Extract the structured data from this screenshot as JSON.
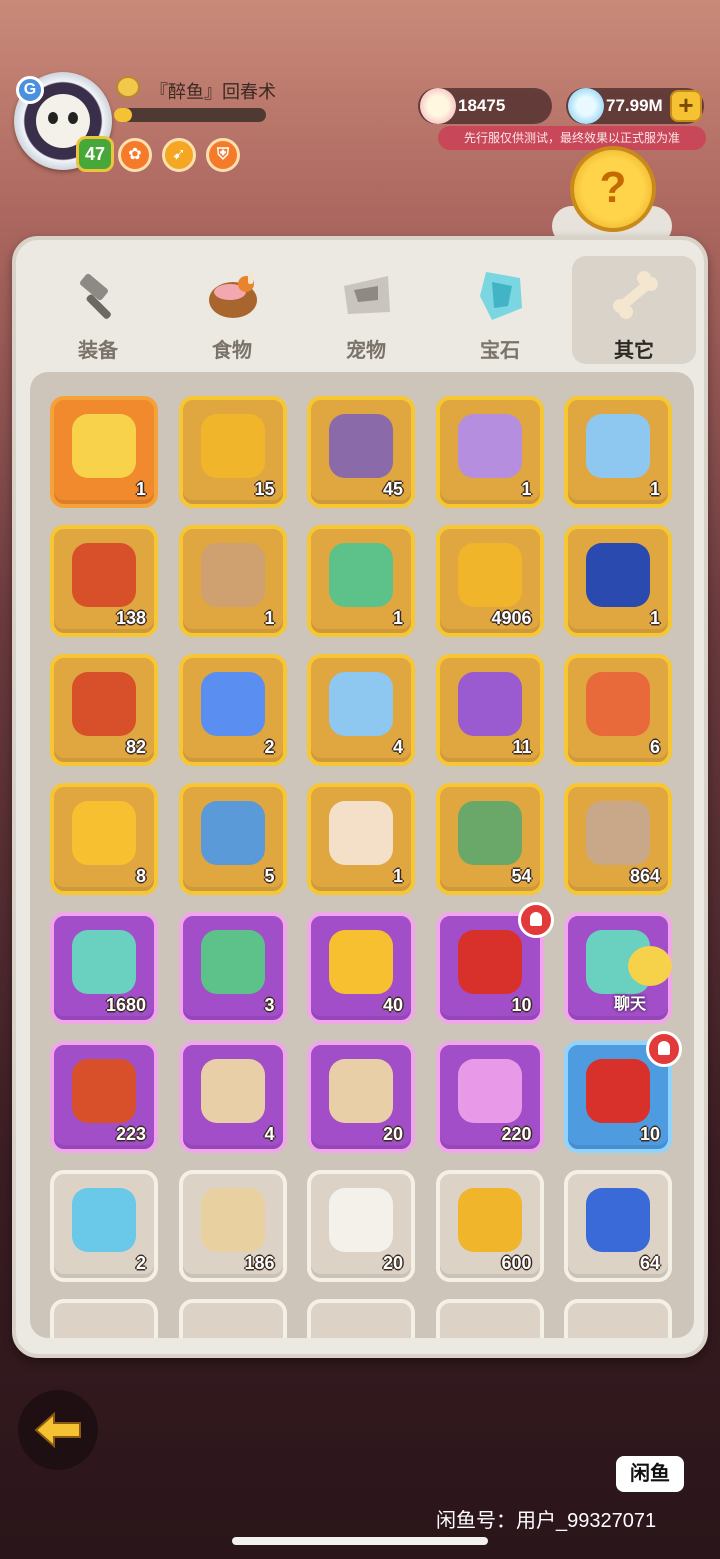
{
  "player": {
    "name": "『醉鱼』回春术",
    "level": "47",
    "exp_fraction": 0.12,
    "avatar_badge": "G"
  },
  "currencies": [
    {
      "icon": "pearl-shell-icon",
      "value": "18475"
    },
    {
      "icon": "crystal-icon",
      "value": "77.99M"
    }
  ],
  "notice": "先行服仅供测试，最终效果以正式服为准",
  "tabs": [
    {
      "label": "装备",
      "icon": "hammer-icon",
      "active": false
    },
    {
      "label": "食物",
      "icon": "food-bowl-icon",
      "active": false
    },
    {
      "label": "宠物",
      "icon": "pet-skull-icon",
      "active": false
    },
    {
      "label": "宝石",
      "icon": "gem-icon",
      "active": false
    },
    {
      "label": "其它",
      "icon": "bone-icon",
      "active": true
    }
  ],
  "items": [
    {
      "count": "1",
      "rarity": "orange",
      "icon": "boar-crystal-icon"
    },
    {
      "count": "15",
      "rarity": "gold",
      "icon": "cake-coin-icon"
    },
    {
      "count": "45",
      "rarity": "gold",
      "icon": "purple-chest-icon"
    },
    {
      "count": "1",
      "rarity": "gold",
      "icon": "purple-pet-bag-icon"
    },
    {
      "count": "1",
      "rarity": "gold",
      "icon": "blue-gem-bag-icon"
    },
    {
      "count": "138",
      "rarity": "gold",
      "icon": "red-chest-icon"
    },
    {
      "count": "1",
      "rarity": "gold",
      "icon": "stone-tablet-icon"
    },
    {
      "count": "1",
      "rarity": "gold",
      "icon": "green-gem-bag-icon"
    },
    {
      "count": "4906",
      "rarity": "gold",
      "icon": "gold-coin-icon"
    },
    {
      "count": "1",
      "rarity": "gold",
      "icon": "skill-orb-icon"
    },
    {
      "count": "82",
      "rarity": "gold",
      "icon": "red-chest-icon"
    },
    {
      "count": "2",
      "rarity": "gold",
      "icon": "winged-badge-icon"
    },
    {
      "count": "4",
      "rarity": "gold",
      "icon": "blue-gem-bag-icon"
    },
    {
      "count": "11",
      "rarity": "gold",
      "icon": "purple-swirl-bag-icon"
    },
    {
      "count": "6",
      "rarity": "gold",
      "icon": "coin-bag-icon"
    },
    {
      "count": "8",
      "rarity": "gold",
      "icon": "amber-stone-icon"
    },
    {
      "count": "5",
      "rarity": "gold",
      "icon": "blue-scroll-icon"
    },
    {
      "count": "1",
      "rarity": "gold",
      "icon": "character-face-icon"
    },
    {
      "count": "54",
      "rarity": "gold",
      "icon": "green-statue-icon"
    },
    {
      "count": "864",
      "rarity": "gold",
      "icon": "stone-statue-icon"
    },
    {
      "count": "1680",
      "rarity": "purple",
      "icon": "teal-ticket-icon"
    },
    {
      "count": "3",
      "rarity": "purple",
      "icon": "green-gem-bag-icon"
    },
    {
      "count": "40",
      "rarity": "purple",
      "icon": "gold-star-icon"
    },
    {
      "count": "10",
      "rarity": "purple",
      "icon": "red-envelope-icon",
      "bell": true
    },
    {
      "count": "",
      "rarity": "purple",
      "icon": "teal-ticket-icon"
    },
    {
      "count": "223",
      "rarity": "purple",
      "icon": "red-chest-icon"
    },
    {
      "count": "4",
      "rarity": "purple",
      "icon": "mystery-meat-icon"
    },
    {
      "count": "20",
      "rarity": "purple",
      "icon": "mystery-meat-icon"
    },
    {
      "count": "220",
      "rarity": "purple",
      "icon": "pink-crystal-icon"
    },
    {
      "count": "10",
      "rarity": "blue",
      "icon": "red-envelope-icon",
      "bell": true
    },
    {
      "count": "2",
      "rarity": "white",
      "icon": "gender-card-icon"
    },
    {
      "count": "186",
      "rarity": "white",
      "icon": "spotted-bag-icon"
    },
    {
      "count": "20",
      "rarity": "white",
      "icon": "dice-icon"
    },
    {
      "count": "600",
      "rarity": "white",
      "icon": "sun-coin-icon"
    },
    {
      "count": "64",
      "rarity": "white",
      "icon": "blue-ore-icon"
    }
  ],
  "chat_label": "聊天",
  "footer": {
    "logo": "闲鱼",
    "watermark": "闲鱼号：用户_99327071"
  },
  "colors": {
    "gold_frame": "#f6c633",
    "purple_frame": "#f2a6ea",
    "blue_frame": "#8fd3ff",
    "white_frame": "#f5f0e6",
    "orange_frame": "#f6a23a"
  }
}
